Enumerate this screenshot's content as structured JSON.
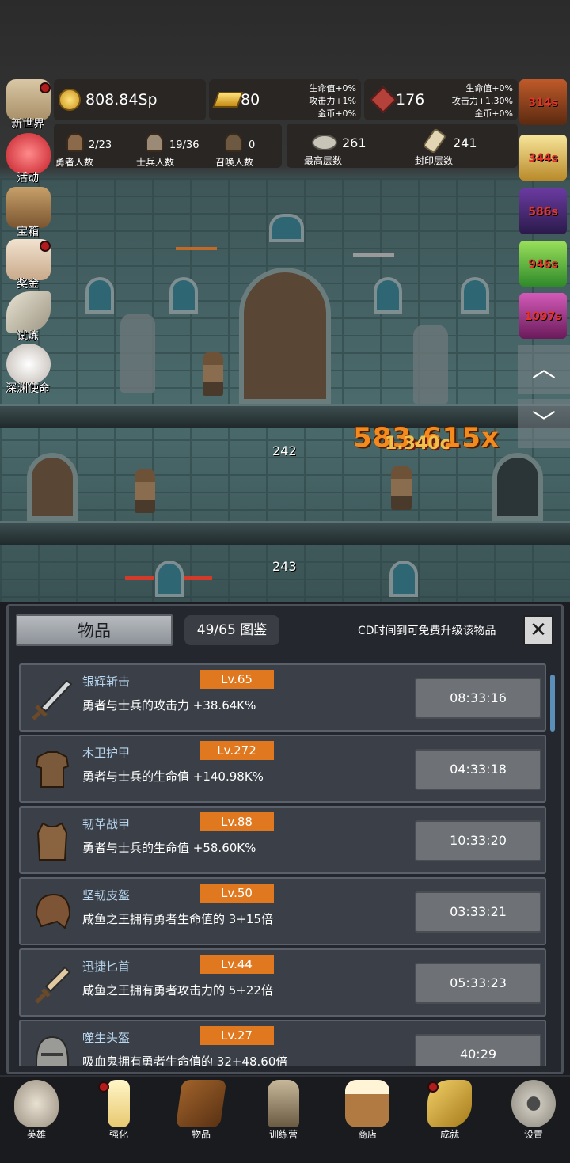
{
  "resources": {
    "gold": "808.84Sp",
    "goldbar": "80",
    "goldbar_bonus": [
      "生命值+0%",
      "攻击力+1%",
      "金币+0%"
    ],
    "gem": "176",
    "gem_bonus": [
      "生命值+0%",
      "攻击力+1.30%",
      "金币+0%"
    ]
  },
  "counts": {
    "heroes": {
      "value": "2/23",
      "label": "勇者人数"
    },
    "soldiers": {
      "value": "19/36",
      "label": "士兵人数"
    },
    "summons": {
      "value": "0",
      "label": "召唤人数"
    },
    "max_floor": {
      "value": "261",
      "label": "最高层数"
    },
    "sealed_floor": {
      "value": "241",
      "label": "封印层数"
    }
  },
  "side_menu": [
    "新世界",
    "活动",
    "宝箱",
    "奖金",
    "试炼",
    "深渊使命"
  ],
  "buffs": [
    "314s",
    "344s",
    "586s",
    "946s",
    "1097s"
  ],
  "scene": {
    "floor_a": "242",
    "floor_b": "243",
    "damage": "583.615",
    "damage_suffix": "x",
    "damage_sub": "1.340c"
  },
  "panel": {
    "title": "物品",
    "collection": "49/65 图鉴",
    "hint": "CD时间到可免费升级该物品",
    "close": "✕"
  },
  "items": [
    {
      "name": "银辉斩击",
      "level": "Lv.65",
      "desc": "勇者与士兵的攻击力 +38.64K%",
      "timer": "08:33:16",
      "icon": "sword-icon"
    },
    {
      "name": "木卫护甲",
      "level": "Lv.272",
      "desc": "勇者与士兵的生命值 +140.98K%",
      "timer": "04:33:18",
      "icon": "wooden-armor-icon"
    },
    {
      "name": "韧革战甲",
      "level": "Lv.88",
      "desc": "勇者与士兵的生命值 +58.60K%",
      "timer": "10:33:20",
      "icon": "leather-armor-icon"
    },
    {
      "name": "坚韧皮盔",
      "level": "Lv.50",
      "desc": "咸鱼之王拥有勇者生命值的 3+15倍",
      "timer": "03:33:21",
      "icon": "leather-helmet-icon"
    },
    {
      "name": "迅捷匕首",
      "level": "Lv.44",
      "desc": "咸鱼之王拥有勇者攻击力的 5+22倍",
      "timer": "05:33:23",
      "icon": "dagger-icon"
    },
    {
      "name": "噬生头盔",
      "level": "Lv.27",
      "desc": "吸血鬼拥有勇者生命值的 32+48.60倍",
      "timer": "40:29",
      "icon": "iron-helmet-icon"
    }
  ],
  "bottom_nav": [
    "英雄",
    "强化",
    "物品",
    "训练营",
    "商店",
    "成就",
    "设置"
  ]
}
